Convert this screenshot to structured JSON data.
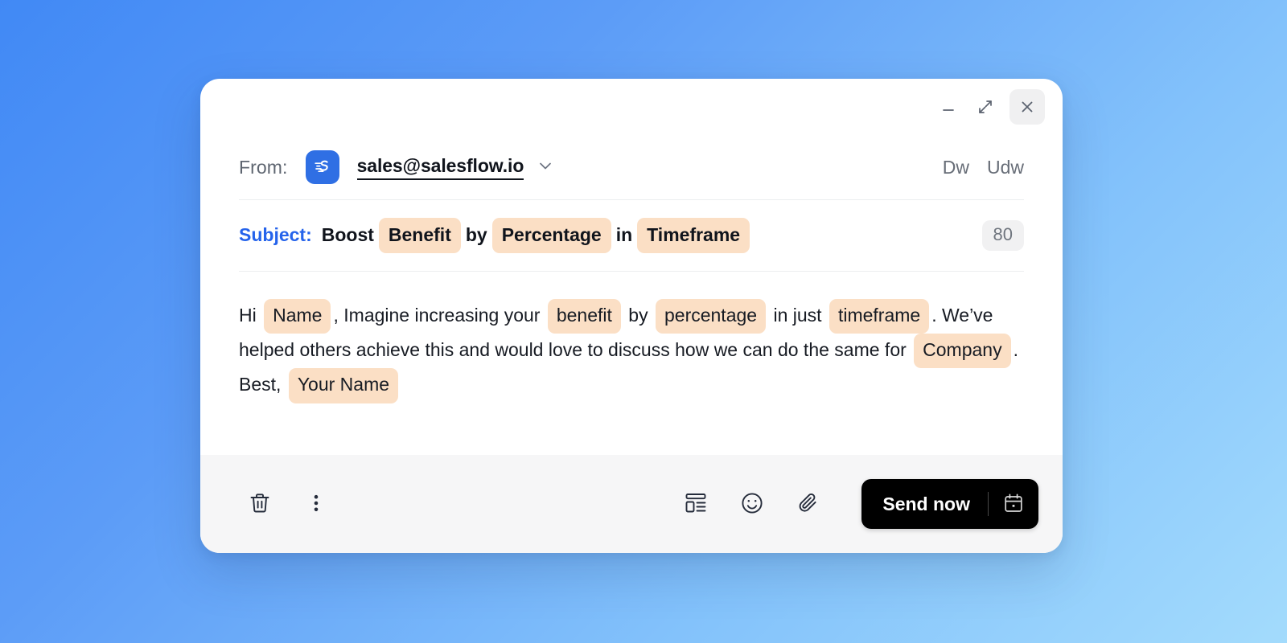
{
  "window": {
    "controls": {
      "minimize": "minimize",
      "expand": "expand",
      "close": "close"
    }
  },
  "from": {
    "label": "From:",
    "address": "sales@salesflow.io",
    "brand_icon": "salesflow-logo-icon",
    "caret_icon": "chevron-down-icon",
    "extras": [
      "Dw",
      "Udw"
    ]
  },
  "subject": {
    "label": "Subject:",
    "parts": [
      {
        "type": "text",
        "value": "Boost"
      },
      {
        "type": "token",
        "value": "Benefit"
      },
      {
        "type": "text",
        "value": "by"
      },
      {
        "type": "token",
        "value": "Percentage"
      },
      {
        "type": "text",
        "value": "in"
      },
      {
        "type": "token",
        "value": "Timeframe"
      }
    ],
    "char_count": "80"
  },
  "body": {
    "parts": [
      {
        "type": "text",
        "value": "Hi "
      },
      {
        "type": "token",
        "value": "Name"
      },
      {
        "type": "text",
        "value": ", Imagine increasing your "
      },
      {
        "type": "token",
        "value": "benefit"
      },
      {
        "type": "text",
        "value": " by "
      },
      {
        "type": "token",
        "value": "percentage"
      },
      {
        "type": "text",
        "value": " in just "
      },
      {
        "type": "token",
        "value": "timeframe"
      },
      {
        "type": "text",
        "value": ". We’ve helped others achieve this and would love to discuss how we can do the same for "
      },
      {
        "type": "token",
        "value": "Company"
      },
      {
        "type": "text",
        "value": ". Best, "
      },
      {
        "type": "token",
        "value": "Your Name"
      }
    ]
  },
  "toolbar": {
    "left": [
      {
        "name": "delete-draft",
        "icon": "trash-icon"
      },
      {
        "name": "more-options",
        "icon": "more-vertical-icon"
      }
    ],
    "right": [
      {
        "name": "insert-template",
        "icon": "template-layout-icon"
      },
      {
        "name": "insert-emoji",
        "icon": "smiley-icon"
      },
      {
        "name": "attach-file",
        "icon": "paperclip-icon"
      }
    ],
    "send_label": "Send now",
    "schedule_icon": "calendar-icon"
  },
  "colors": {
    "accent_blue": "#2563eb",
    "brand_logo_blue": "#2f6FE4",
    "token_highlight": "#FBDFC5",
    "send_button": "#000000",
    "footer_bg": "#F6F6F7",
    "background_gradient_start": "#4189F5",
    "background_gradient_end": "#A3DBFC"
  }
}
